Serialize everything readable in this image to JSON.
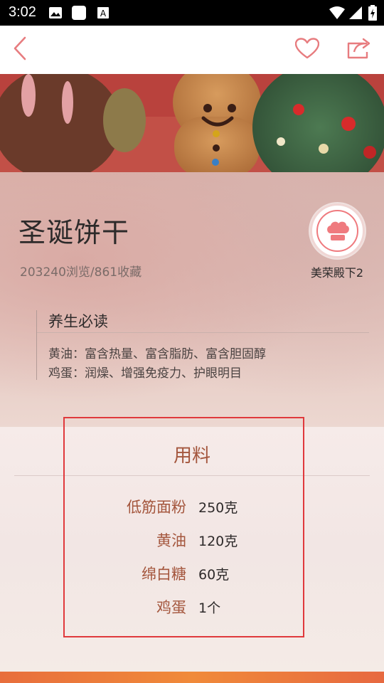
{
  "status_bar": {
    "time": "3:02",
    "icons": [
      "image-icon",
      "square-icon",
      "a-icon",
      "wifi-icon",
      "signal-icon",
      "battery-icon"
    ]
  },
  "top_bar": {
    "back_icon": "chevron-left-icon",
    "favorite_icon": "heart-icon",
    "share_icon": "share-icon",
    "accent_color": "#e77c7f"
  },
  "recipe": {
    "title": "圣诞饼干",
    "stats": "203240浏览/861收藏",
    "author": "美荣殿下2",
    "avatar_icon": "chef-hat-icon"
  },
  "health": {
    "title": "养生必读",
    "lines": [
      "黄油：富含热量、富含脂肪、富含胆固醇",
      "鸡蛋：润燥、增强免疫力、护眼明目"
    ]
  },
  "ingredients": {
    "title": "用料",
    "items": [
      {
        "name": "低筋面粉",
        "qty": "250克"
      },
      {
        "name": "黄油",
        "qty": "120克"
      },
      {
        "name": "绵白糖",
        "qty": "60克"
      },
      {
        "name": "鸡蛋",
        "qty": "1个"
      }
    ]
  }
}
